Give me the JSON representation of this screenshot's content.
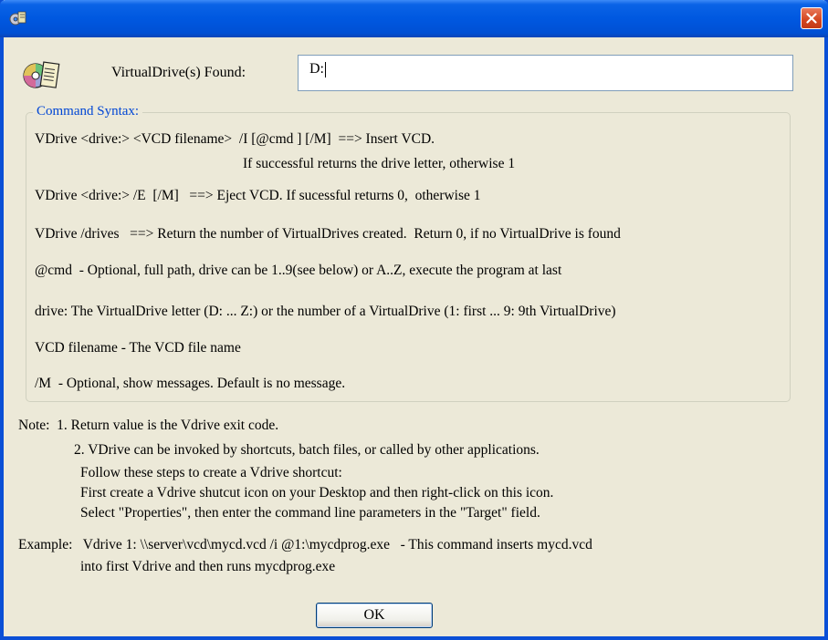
{
  "window": {
    "title": ""
  },
  "found": {
    "label": "VirtualDrive(s) Found:",
    "value": "D:"
  },
  "syntax": {
    "legend": "Command Syntax:",
    "lines": [
      "VDrive <drive:> <VCD filename>  /I [@cmd ] [/M]  ==> Insert VCD.",
      "If successful returns the drive letter, otherwise 1",
      "VDrive <drive:> /E  [/M]   ==> Eject VCD. If sucessful returns 0,  otherwise 1",
      "VDrive /drives   ==> Return the number of VirtualDrives created.  Return 0, if no VirtualDrive is found",
      "@cmd  - Optional, full path, drive can be 1..9(see below) or A..Z, execute the program at last",
      "drive: The VirtualDrive letter (D: ... Z:) or the number of a VirtualDrive (1: first ... 9: 9th VirtualDrive)",
      "VCD filename - The VCD file name",
      "/M  - Optional, show messages. Default is no message."
    ]
  },
  "notes": {
    "lines": [
      "Note:  1. Return value is the Vdrive exit code.",
      "2. VDrive can be invoked by shortcuts, batch files, or called by other applications.",
      "Follow these steps to create a Vdrive shortcut:",
      "First create a Vdrive shutcut icon on your Desktop and then right-click on this icon.",
      "Select \"Properties\", then enter the command line parameters in the \"Target\" field.",
      "Example:   Vdrive 1: \\\\server\\vcd\\mycd.vcd /i @1:\\mycdprog.exe   - This command inserts mycd.vcd",
      "into first Vdrive and then runs mycdprog.exe"
    ]
  },
  "buttons": {
    "ok": "OK"
  },
  "colors": {
    "titlebar": "#0058e0",
    "window_bg": "#ece9d8",
    "legend": "#0046d5",
    "close": "#d3451f"
  },
  "icons": {
    "app": "app-icon",
    "cd": "cd-drive-icon",
    "close": "close-icon"
  }
}
